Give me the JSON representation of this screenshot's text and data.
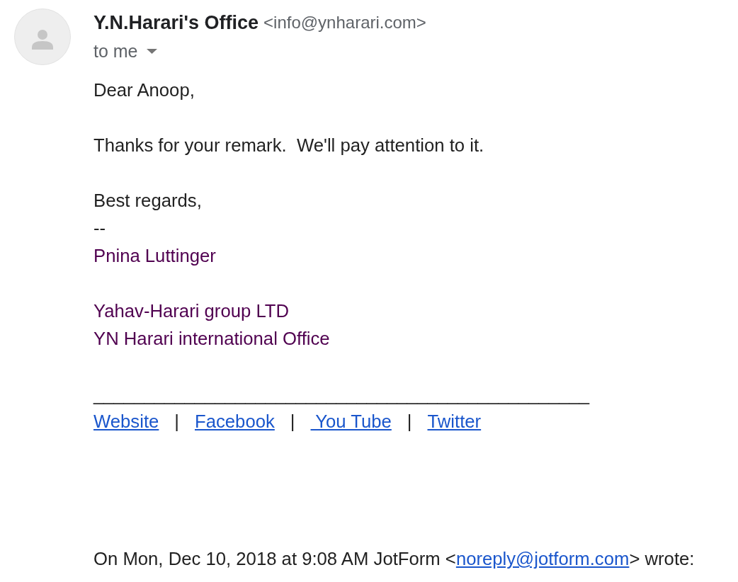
{
  "sender": {
    "name": "Y.N.Harari's Office",
    "email": "<info@ynharari.com>"
  },
  "recipient": {
    "label": "to me"
  },
  "body": {
    "greeting": "Dear Anoop,",
    "message": "Thanks for your remark.  We'll pay attention to it.",
    "closing": "Best regards,",
    "dash": "--"
  },
  "signature": {
    "name": "Pnina Luttinger",
    "organization": [
      "Yahav-Harari group LTD",
      "YN Harari international Office"
    ],
    "rule": "_________________________________________________",
    "links": [
      {
        "label": "Website"
      },
      {
        "separator": "|",
        "label": "Facebook"
      },
      {
        "separator": "|",
        "label": " You Tube"
      },
      {
        "separator": "|",
        "label": "Twitter"
      }
    ]
  },
  "quote_header": {
    "text_before": "On Mon, Dec 10, 2018 at 9:08 AM JotForm <",
    "link": "noreply@jotform.com",
    "text_after": "> wrote:"
  }
}
